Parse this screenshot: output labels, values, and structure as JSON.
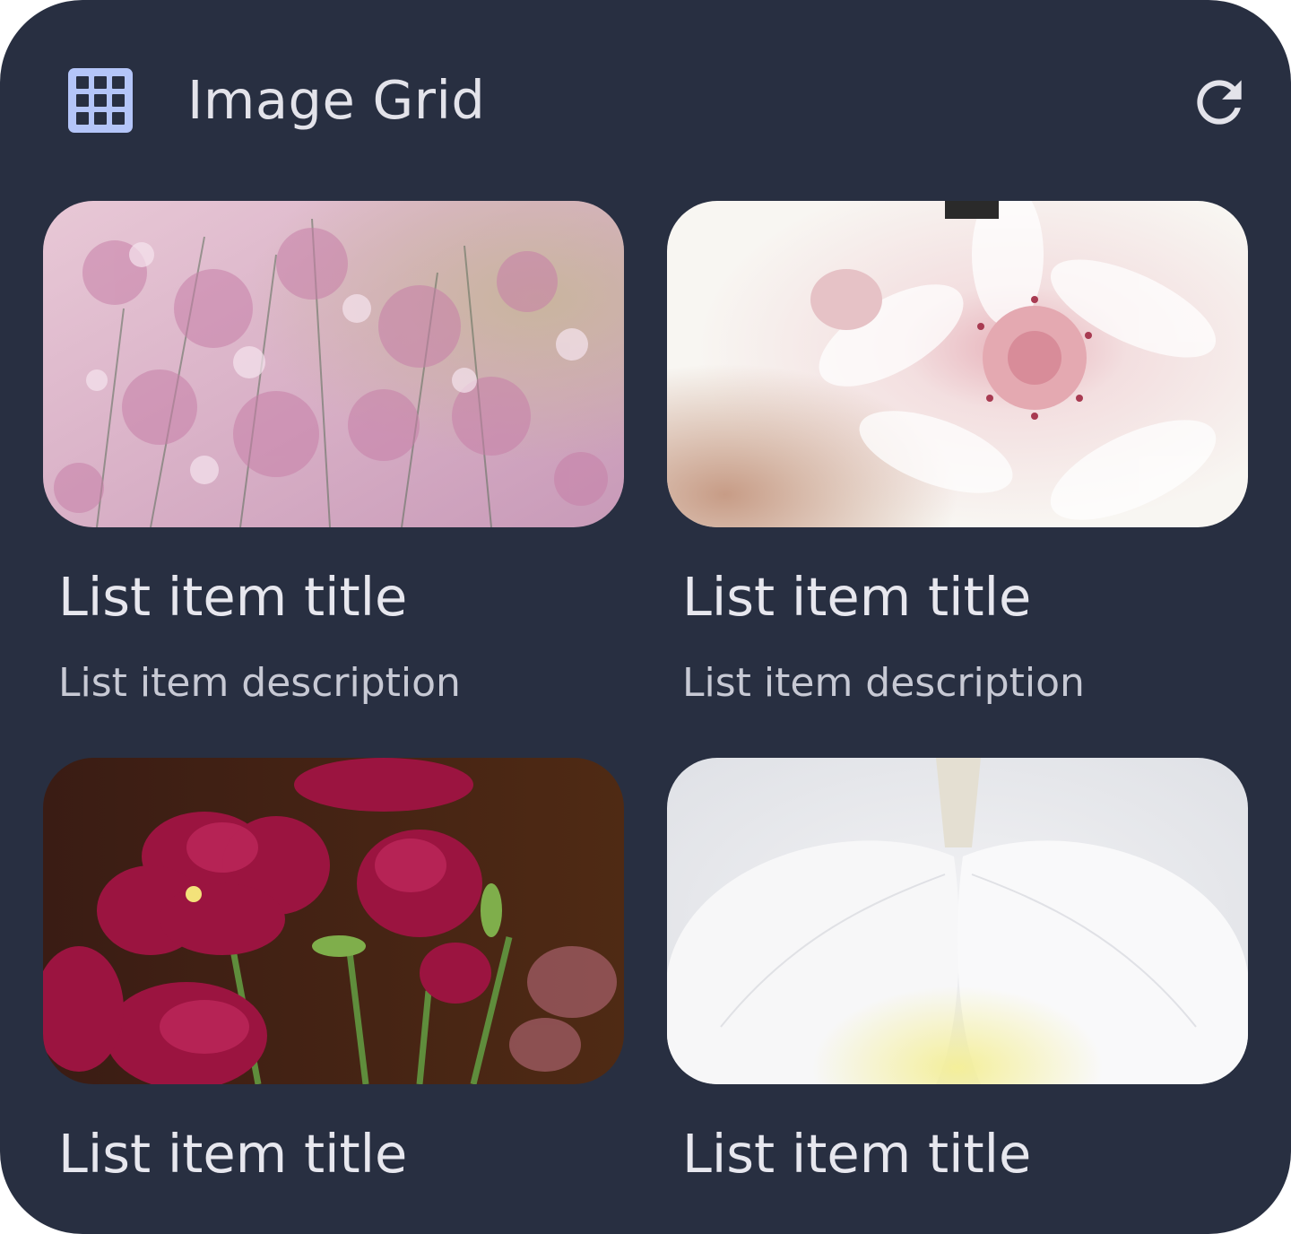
{
  "header": {
    "title": "Image Grid",
    "leading_icon": "grid-icon",
    "action_icon": "refresh-icon"
  },
  "colors": {
    "background": "#282f41",
    "accent": "#b4c5f8",
    "text_primary": "#e7e7ee",
    "text_secondary": "#c7c9d4"
  },
  "items": [
    {
      "title": "List item title",
      "description": "List item description",
      "image": "pink-limonium-flowers-photo"
    },
    {
      "title": "List item title",
      "description": "List item description",
      "image": "white-pink-protea-flower-photo"
    },
    {
      "title": "List item title",
      "description": "",
      "image": "magenta-pansy-flowers-photo"
    },
    {
      "title": "List item title",
      "description": "",
      "image": "white-orchid-petals-photo"
    }
  ]
}
